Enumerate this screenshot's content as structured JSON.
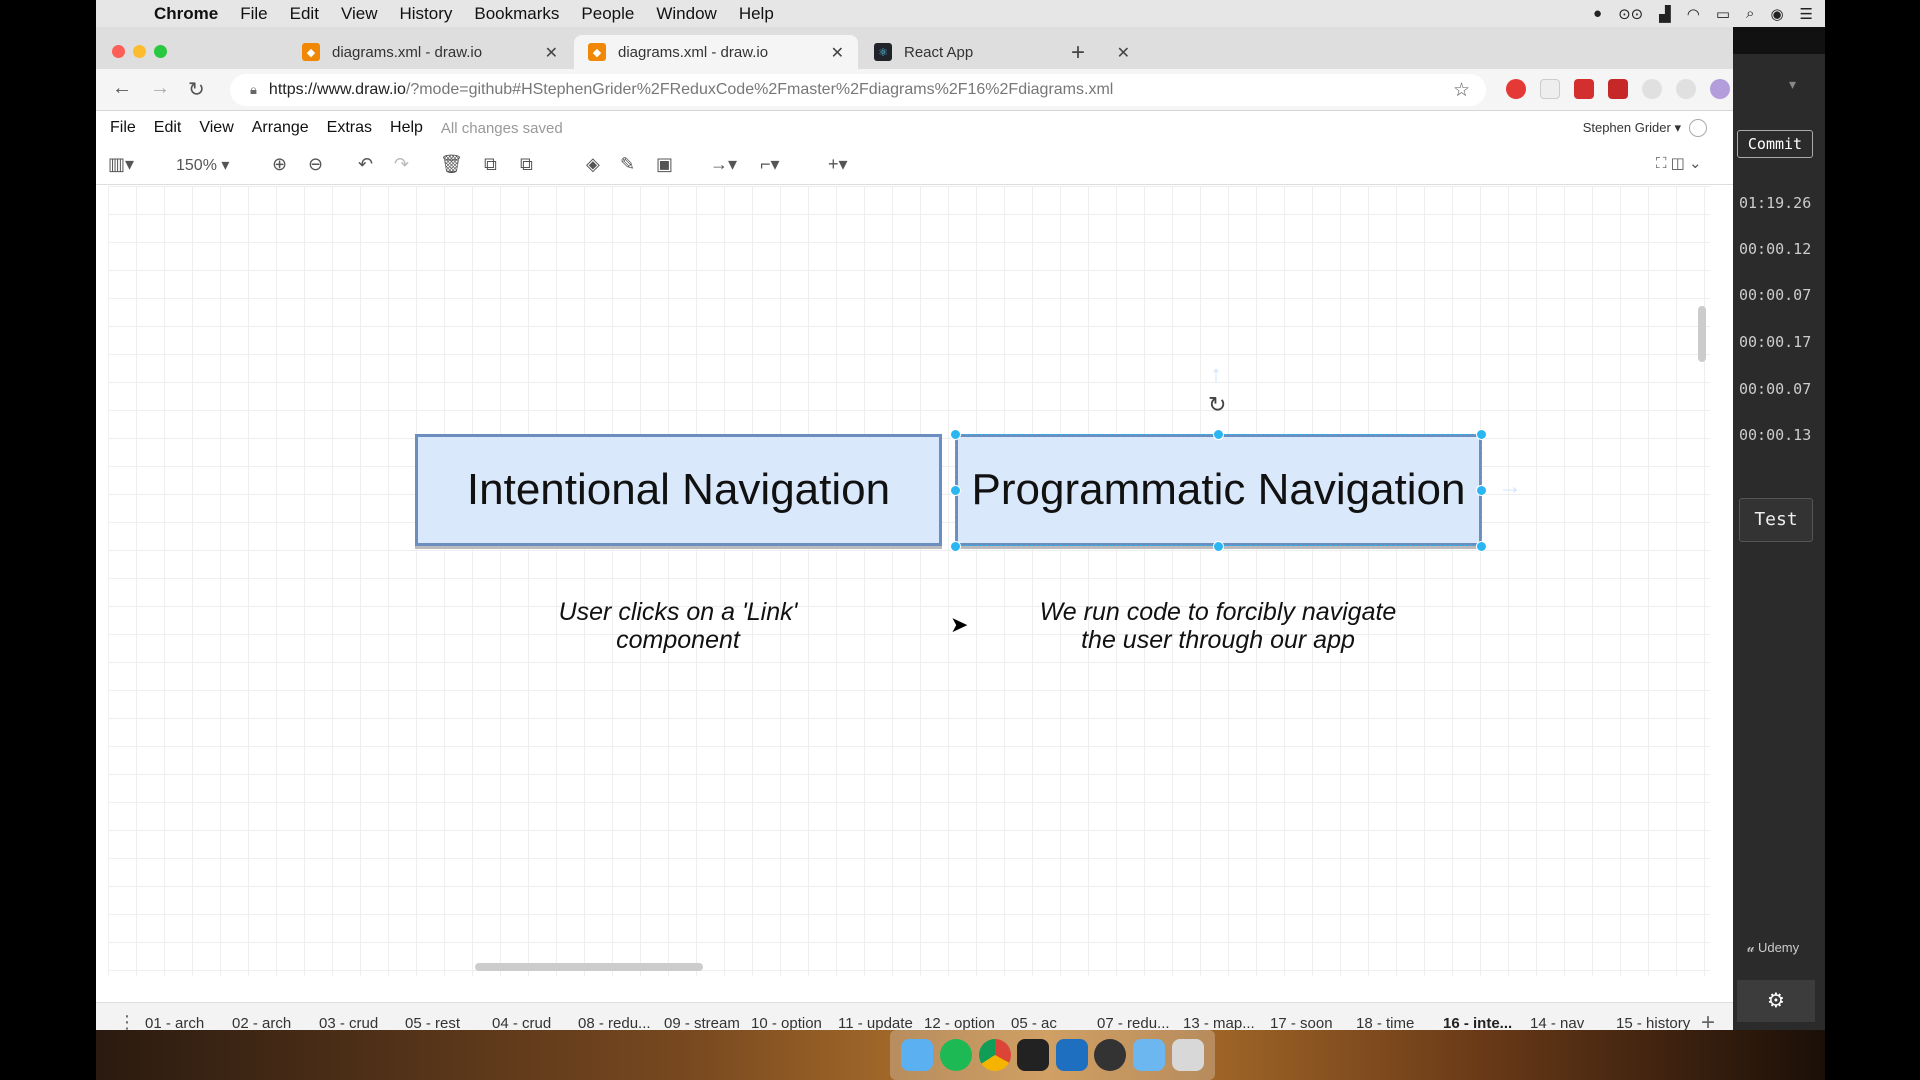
{
  "menubar": {
    "items": [
      "Chrome",
      "File",
      "Edit",
      "View",
      "History",
      "Bookmarks",
      "People",
      "Window",
      "Help"
    ]
  },
  "browser": {
    "tabs": [
      {
        "title": "diagrams.xml - draw.io",
        "active": false
      },
      {
        "title": "diagrams.xml - draw.io",
        "active": true
      },
      {
        "title": "React App",
        "active": false
      }
    ],
    "url_host": "https://www.draw.io",
    "url_rest": "/?mode=github#HStephenGrider%2FReduxCode%2Fmaster%2Fdiagrams%2F16%2Fdiagrams.xml"
  },
  "drawio": {
    "menu": [
      "File",
      "Edit",
      "View",
      "Arrange",
      "Extras",
      "Help"
    ],
    "save_status": "All changes saved",
    "user": "Stephen Grider",
    "zoom": "150%"
  },
  "diagram": {
    "box_left": "Intentional Navigation",
    "box_right": "Programmatic Navigation",
    "caption_left_1": "User clicks on a 'Link'",
    "caption_left_2": "component",
    "caption_right_1": "We run code to forcibly navigate",
    "caption_right_2": "the user through our app"
  },
  "pages": [
    "01 - arch",
    "02 - arch",
    "03 - crud",
    "05 - rest",
    "04 - crud",
    "08 - redu...",
    "09 - stream",
    "10 - option",
    "11 - update",
    "12 - option",
    "05 - ac",
    "07 - redu...",
    "13 - map...",
    "17 - soon",
    "18 - time",
    "16 - inte...",
    "14 - nav",
    "15 - history"
  ],
  "active_page": "16 - inte...",
  "right_panel": {
    "commit": "Commit",
    "times": [
      "01:19.26",
      "00:00.12",
      "00:00.07",
      "00:00.17",
      "00:00.07",
      "00:00.13"
    ],
    "test": "Test",
    "brand": "Udemy"
  }
}
